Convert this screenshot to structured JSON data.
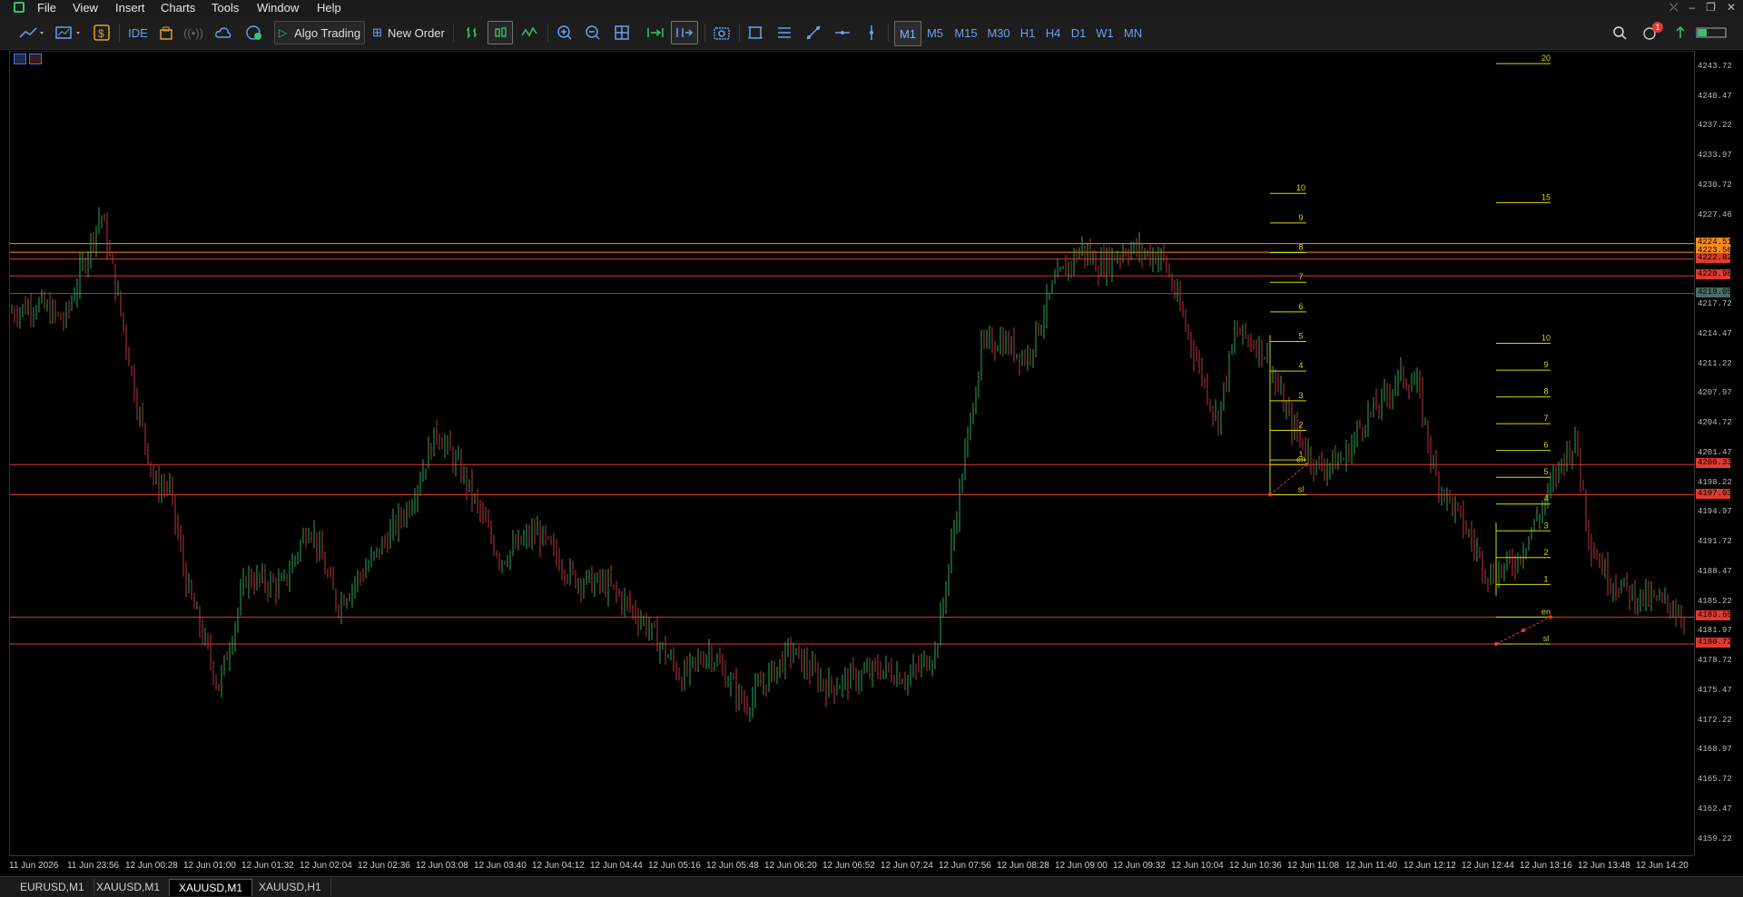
{
  "menu": {
    "items": [
      "File",
      "View",
      "Insert",
      "Charts",
      "Tools",
      "Window",
      "Help"
    ]
  },
  "toolbar": {
    "ide_label": "IDE",
    "algo_label": "Algo Trading",
    "order_label": "New Order",
    "timeframes": [
      "M1",
      "M5",
      "M15",
      "M30",
      "H1",
      "H4",
      "D1",
      "W1",
      "MN"
    ],
    "active_timeframe": "M1",
    "notification_count": "1"
  },
  "price_axis": {
    "labels": [
      "4243.72",
      "4240.47",
      "4237.22",
      "4233.97",
      "4230.72",
      "4227.46",
      "4224.21",
      "4220.96",
      "4217.72",
      "4214.47",
      "4211.22",
      "4207.97",
      "4204.72",
      "4201.47",
      "4198.22",
      "4194.97",
      "4191.72",
      "4188.47",
      "4185.22",
      "4181.97",
      "4178.72",
      "4175.47",
      "4172.22",
      "4168.97",
      "4165.72",
      "4162.47",
      "4159.22"
    ],
    "badges": [
      {
        "value": "4224.51",
        "color": "#ff8c1a"
      },
      {
        "value": "4223.56",
        "color": "#ff8c1a"
      },
      {
        "value": "4222.82",
        "color": "#e03a2f"
      },
      {
        "value": "4220.98",
        "color": "#e03a2f"
      },
      {
        "value": "4219.05",
        "color": "#4a6b6b"
      },
      {
        "value": "4200.33",
        "color": "#e03a2f"
      },
      {
        "value": "4197.03",
        "color": "#e03a2f"
      },
      {
        "value": "4183.65",
        "color": "#e03a2f"
      },
      {
        "value": "4180.72",
        "color": "#e03a2f"
      }
    ]
  },
  "time_axis": {
    "labels": [
      "11 Jun 2026",
      "11 Jun 23:56",
      "12 Jun 00:28",
      "12 Jun 01:00",
      "12 Jun 01:32",
      "12 Jun 02:04",
      "12 Jun 02:36",
      "12 Jun 03:08",
      "12 Jun 03:40",
      "12 Jun 04:12",
      "12 Jun 04:44",
      "12 Jun 05:16",
      "12 Jun 05:48",
      "12 Jun 06:20",
      "12 Jun 06:52",
      "12 Jun 07:24",
      "12 Jun 07:56",
      "12 Jun 08:28",
      "12 Jun 09:00",
      "12 Jun 09:32",
      "12 Jun 10:04",
      "12 Jun 10:36",
      "12 Jun 11:08",
      "12 Jun 11:40",
      "12 Jun 12:12",
      "12 Jun 12:44",
      "12 Jun 13:16",
      "12 Jun 13:48",
      "12 Jun 14:20"
    ]
  },
  "chart": {
    "symbol": "XAUUSD",
    "timeframe": "M1",
    "bull_color": "#2fa35a",
    "bear_color": "#b8383a",
    "level_lines": [
      {
        "price": 4224.51,
        "color": "#ff8c1a"
      },
      {
        "price": 4223.56,
        "color": "#ff8c1a"
      },
      {
        "price": 4222.82,
        "color": "#e03a2f"
      },
      {
        "price": 4220.98,
        "color": "#e03a2f"
      },
      {
        "price": 4219.05,
        "color": "#4a6b6b"
      },
      {
        "price": 4200.33,
        "color": "#e03a2f"
      },
      {
        "price": 4197.03,
        "color": "#e03a2f"
      },
      {
        "price": 4183.65,
        "color": "#e03a2f"
      },
      {
        "price": 4180.72,
        "color": "#e03a2f"
      }
    ],
    "ladder1": [
      "10",
      "9",
      "8",
      "7",
      "6",
      "5",
      "4",
      "3",
      "2",
      "1",
      "en",
      "sl"
    ],
    "ladder2_top": [
      "20",
      "15"
    ],
    "ladder2": [
      "10",
      "9",
      "8",
      "7",
      "6",
      "5",
      "4",
      "3",
      "2",
      "1",
      "en",
      "sl"
    ]
  },
  "tabs": [
    "EURUSD,M1",
    "XAUUSD,M1",
    "XAUUSD,M1",
    "XAUUSD,H1"
  ],
  "active_tab": 2
}
